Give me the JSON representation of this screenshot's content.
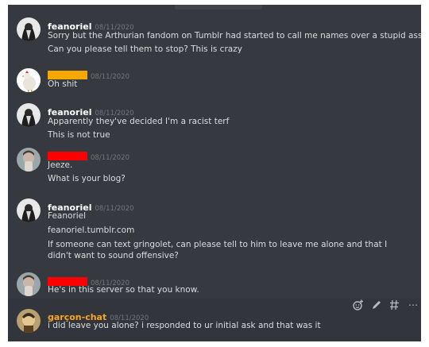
{
  "colors": {
    "background": "#36393f",
    "username": "#ffffff",
    "highlight_username": "#faa61a",
    "timestamp": "#72767d",
    "text": "#dcddde",
    "redact_orange": "#f7a800",
    "redact_red": "#ff0000"
  },
  "messages": [
    {
      "author": "feanoriel",
      "timestamp": "08/11/2020",
      "lines": [
        "Sorry but the Arthurian fandom on Tumblr had started to call me names over a stupid ass question",
        "Can you please tell them to stop? This is crazy"
      ]
    },
    {
      "author": "",
      "timestamp": "08/11/2020",
      "lines": [
        "Oh shit"
      ]
    },
    {
      "author": "feanoriel",
      "timestamp": "08/11/2020",
      "lines": [
        "Apparently they've decided I'm a racist terf",
        "This is not true"
      ]
    },
    {
      "author": "",
      "timestamp": "08/11/2020",
      "lines": [
        "Jeeze.",
        "What is your blog?"
      ]
    },
    {
      "author": "feanoriel",
      "timestamp": "08/11/2020",
      "lines": [
        "Feanoriel",
        "feanoriel.tumblr.com",
        "If someone can text gringolet, can please tell to him to leave me alone and that I didn't want to sound offensive?"
      ]
    },
    {
      "author": "",
      "timestamp": "08/11/2020",
      "lines": [
        "He's in this server so that you know."
      ]
    },
    {
      "author": "garçon-chat",
      "timestamp": "08/11/2020",
      "lines": [
        "i did leave you alone? i responded to ur initial ask and that was it"
      ]
    }
  ],
  "toolbar": {
    "icons": [
      "add-reaction-icon",
      "edit-icon",
      "create-thread-icon",
      "more-icon"
    ],
    "more_label": "⋯"
  }
}
